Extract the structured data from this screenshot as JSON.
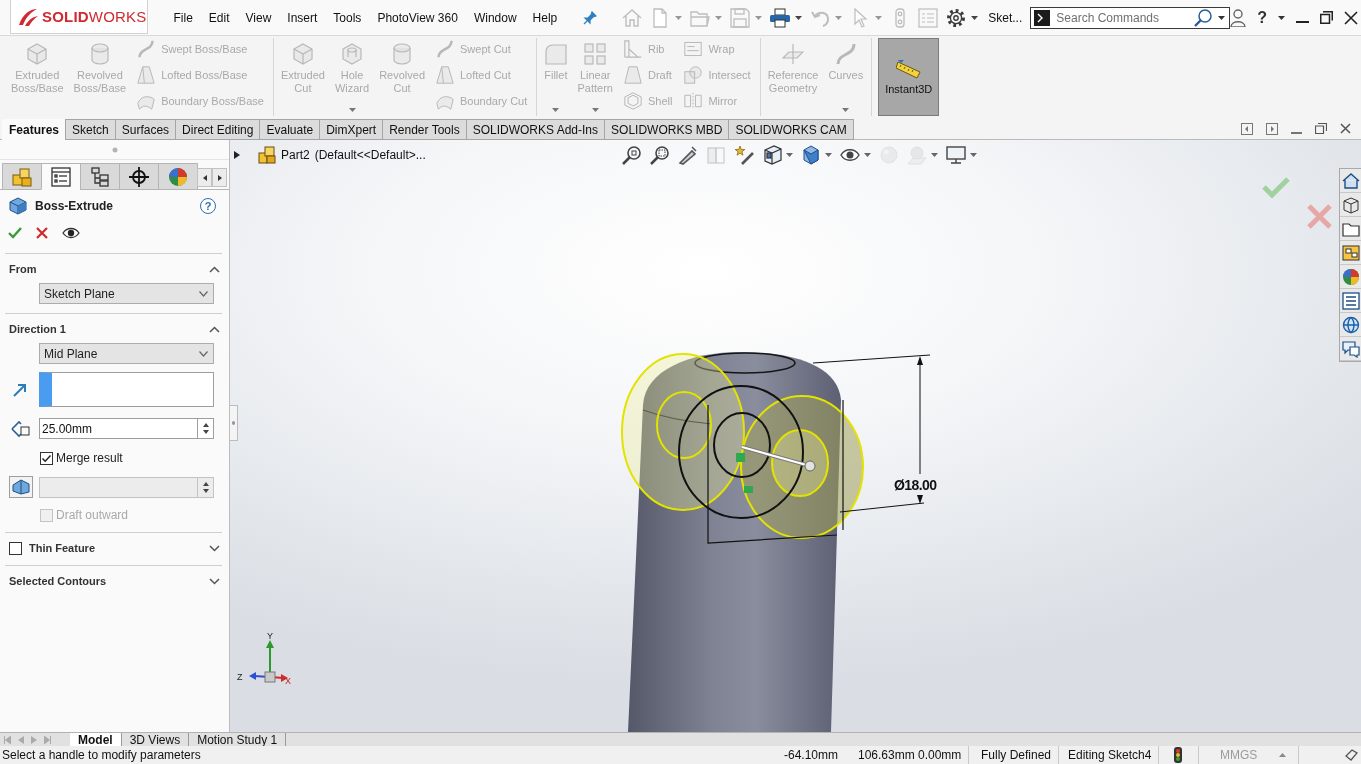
{
  "title_bar": {
    "logo": "**SOLID**WORKS",
    "menu": [
      "File",
      "Edit",
      "View",
      "Insert",
      "Tools",
      "PhotoView 360",
      "Window",
      "Help"
    ],
    "quick_access": [
      {
        "disabled": true,
        "dropdown": false
      },
      {
        "disabled": true,
        "dropdown": true
      },
      {
        "disabled": true,
        "dropdown": true
      },
      {
        "disabled": true,
        "dropdown": true
      },
      {
        "disabled": false,
        "dropdown": true
      },
      {
        "disabled": true,
        "dropdown": true
      },
      {
        "disabled": true,
        "dropdown": true
      },
      {
        "disabled": true,
        "dropdown": false
      },
      {
        "disabled": true,
        "dropdown": false
      },
      {
        "disabled": false,
        "dropdown": true
      }
    ],
    "document": "Sket...",
    "search": {
      "placeholder": "Search Commands"
    },
    "help": "?"
  },
  "ribbon": {
    "groups": [
      {
        "items": [
          {
            "kind": "large",
            "label": "Extruded Boss/Base",
            "disabled": true,
            "dropdown": false
          },
          {
            "kind": "large",
            "label": "Revolved Boss/Base",
            "disabled": true,
            "dropdown": false
          },
          {
            "kind": "column",
            "items": [
              {
                "label": "Swept Boss/Base",
                "disabled": true
              },
              {
                "label": "Lofted Boss/Base",
                "disabled": true
              },
              {
                "label": "Boundary Boss/Base",
                "disabled": true
              }
            ]
          }
        ]
      },
      {
        "items": [
          {
            "kind": "large",
            "label": "Extruded Cut",
            "disabled": true,
            "dropdown": false
          },
          {
            "kind": "large",
            "label": "Hole Wizard",
            "disabled": true,
            "dropdown": true
          },
          {
            "kind": "large",
            "label": "Revolved Cut",
            "disabled": true,
            "dropdown": false
          },
          {
            "kind": "column",
            "items": [
              {
                "label": "Swept Cut",
                "disabled": true
              },
              {
                "label": "Lofted Cut",
                "disabled": true
              },
              {
                "label": "Boundary Cut",
                "disabled": true
              }
            ]
          }
        ]
      },
      {
        "items": [
          {
            "kind": "large",
            "label": "Fillet",
            "disabled": true,
            "dropdown": true
          },
          {
            "kind": "large",
            "label": "Linear Pattern",
            "disabled": true,
            "dropdown": true
          },
          {
            "kind": "column",
            "items": [
              {
                "label": "Rib",
                "disabled": true
              },
              {
                "label": "Draft",
                "disabled": true
              },
              {
                "label": "Shell",
                "disabled": true
              }
            ]
          },
          {
            "kind": "column",
            "items": [
              {
                "label": "Wrap",
                "disabled": true
              },
              {
                "label": "Intersect",
                "disabled": true
              },
              {
                "label": "Mirror",
                "disabled": true
              }
            ]
          }
        ]
      },
      {
        "items": [
          {
            "kind": "large",
            "label": "Reference Geometry",
            "disabled": true,
            "dropdown": false
          },
          {
            "kind": "large",
            "label": "Curves",
            "disabled": true,
            "dropdown": true
          }
        ]
      }
    ],
    "instant3d_button": {
      "label": "Instant3D",
      "pressed": true
    }
  },
  "command_tabs": [
    {
      "label": "Features",
      "selected": true
    },
    {
      "label": "Sketch",
      "selected": false
    },
    {
      "label": "Surfaces",
      "selected": false
    },
    {
      "label": "Direct Editing",
      "selected": false
    },
    {
      "label": "Evaluate",
      "selected": false
    },
    {
      "label": "DimXpert",
      "selected": false
    },
    {
      "label": "Render Tools",
      "selected": false
    },
    {
      "label": "SOLIDWORKS Add-Ins",
      "selected": false
    },
    {
      "label": "SOLIDWORKS MBD",
      "selected": false
    },
    {
      "label": "SOLIDWORKS CAM",
      "selected": false
    }
  ],
  "property_manager": {
    "tabs": [
      {
        "selected": false
      },
      {
        "selected": true
      },
      {
        "selected": false
      },
      {
        "selected": false
      },
      {
        "selected": false
      }
    ],
    "title": "Boss-Extrude",
    "help": "?",
    "from": {
      "title": "From",
      "expanded": true,
      "start": "Sketch Plane"
    },
    "direction_1": {
      "title": "Direction 1",
      "expanded": true,
      "end_condition": "Mid Plane",
      "depth": "25.00mm",
      "merge_result": {
        "label": "Merge result",
        "checked": true
      },
      "draft_angle": {
        "disabled": true
      },
      "draft_outward": {
        "label": "Draft outward",
        "checked": false,
        "disabled": true
      }
    },
    "thin_feature": {
      "title": "Thin Feature",
      "checked": false,
      "expanded": false
    },
    "selected_contours": {
      "title": "Selected Contours",
      "expanded": false
    }
  },
  "viewport": {
    "tree": {
      "expanded": false,
      "name": "Part2",
      "configuration": "(Default<<Default>..."
    },
    "heads_up_toolbar": [
      {
        "disabled": false,
        "dropdown": false
      },
      {
        "disabled": false,
        "dropdown": false
      },
      {
        "disabled": false,
        "dropdown": false
      },
      {
        "disabled": true,
        "dropdown": false
      },
      {
        "disabled": false,
        "dropdown": false
      },
      {
        "disabled": false,
        "dropdown": true
      },
      {
        "disabled": false,
        "dropdown": true
      },
      {
        "disabled": false,
        "dropdown": true
      },
      {
        "disabled": true,
        "dropdown": false
      },
      {
        "disabled": true,
        "dropdown": true
      },
      {
        "disabled": false,
        "dropdown": true
      }
    ],
    "dimension": "Ø18.00",
    "triad": [
      "Y",
      "Z",
      "X"
    ]
  },
  "bottom_tabs": [
    {
      "label": "Model",
      "selected": true
    },
    {
      "label": "3D Views",
      "selected": false
    },
    {
      "label": "Motion Study 1",
      "selected": false
    }
  ],
  "status_bar": {
    "message": "Select a handle to modify parameters",
    "coordinates": [
      "-64.10mm",
      "106.63mm",
      "0.00mm"
    ],
    "sketch_state": "Fully Defined",
    "mode": "Editing Sketch4",
    "units": "MMGS"
  }
}
